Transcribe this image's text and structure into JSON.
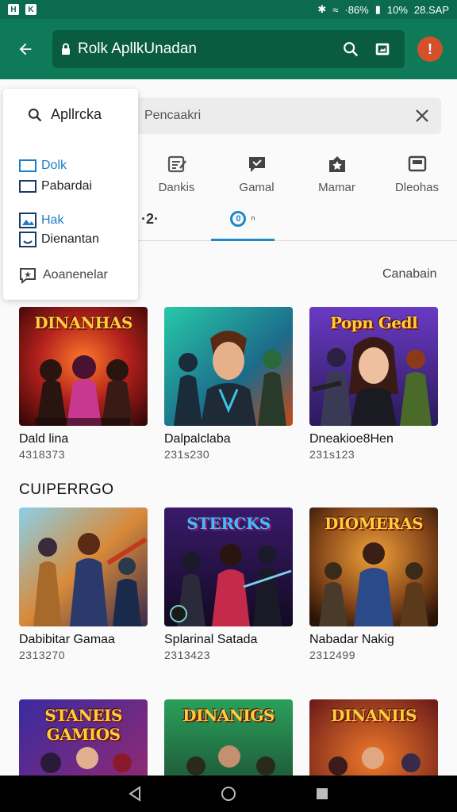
{
  "status_bar": {
    "left_icons": [
      "H",
      "K"
    ],
    "signal_text": "·86%",
    "battery_text": "10%",
    "time": "28.SAP"
  },
  "app_bar": {
    "url_text": "Rolk ApllkUnadan",
    "colors": {
      "bar": "#0f7a58",
      "url_box": "#0a5c40",
      "alert": "#d2502a"
    }
  },
  "dropdown": {
    "header": "Apllrcka",
    "items": [
      {
        "label": "Dolk",
        "style": "blue",
        "icon": "checkbox-icon"
      },
      {
        "label": "Pabardai",
        "style": "plain",
        "icon": "checkbox-icon"
      },
      {
        "label": "Hak",
        "style": "blue",
        "icon": "image-icon"
      },
      {
        "label": "Dienantan",
        "style": "plain",
        "icon": "emoji-icon"
      }
    ],
    "footer": "Aoanenelar"
  },
  "search": {
    "placeholder": "Pencaakri"
  },
  "category_tabs": [
    {
      "label": "Dankis",
      "icon": "article-icon"
    },
    {
      "label": "Gamal",
      "icon": "chat-icon"
    },
    {
      "label": "Mamar",
      "icon": "star-badge-icon"
    },
    {
      "label": "Dleohas",
      "icon": "window-icon"
    }
  ],
  "sub_tabs": {
    "first": "·2·",
    "second_badge": "0",
    "second_label": "ⁿ"
  },
  "link_right": "Canabain",
  "section_title": "CUIPERRGO",
  "cards_row1": [
    {
      "title": "Dald lina",
      "count": "4318373",
      "logo": "DINANHAS"
    },
    {
      "title": "Dalpalclaba",
      "count": "231s230",
      "logo": ""
    },
    {
      "title": "Dneakioe8Hen",
      "count": "231s123",
      "logo": "Popn Gedl"
    }
  ],
  "cards_row2": [
    {
      "title": "Dabibitar Gamaa",
      "count": "2313270",
      "logo": ""
    },
    {
      "title": "Splarinal Satada",
      "count": "2313423",
      "logo": "STERCKS"
    },
    {
      "title": "Nabadar Nakig",
      "count": "2312499",
      "logo": "DIOMERAS"
    }
  ],
  "cards_row3": [
    {
      "logo": "STANEIS GAMIOS"
    },
    {
      "logo": "DINANIGS"
    },
    {
      "logo": "DINANIIS"
    }
  ]
}
